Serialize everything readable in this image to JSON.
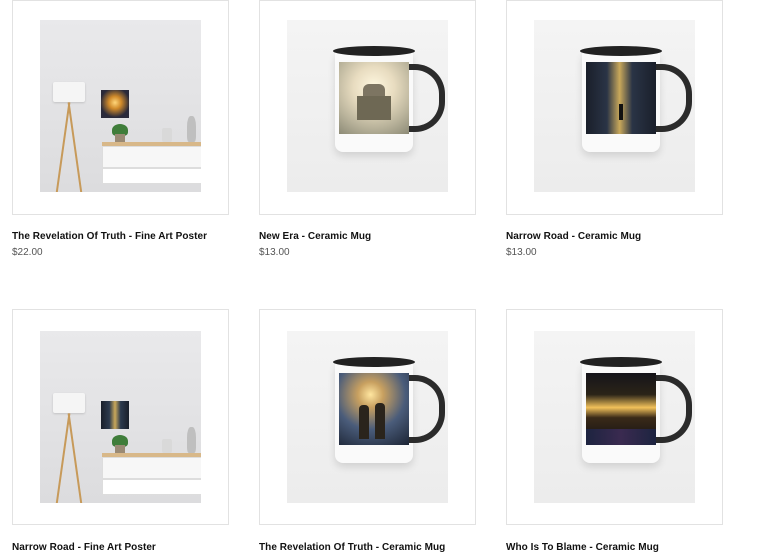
{
  "products": [
    {
      "title": "The Revelation Of Truth - Fine Art Poster",
      "price": "$22.00",
      "image": "poster-room"
    },
    {
      "title": "New Era - Ceramic Mug",
      "price": "$13.00",
      "image": "mug-castle"
    },
    {
      "title": "Narrow Road - Ceramic Mug",
      "price": "$13.00",
      "image": "mug-city"
    },
    {
      "title": "Narrow Road - Fine Art Poster",
      "price": "",
      "image": "poster-room"
    },
    {
      "title": "The Revelation Of Truth - Ceramic Mug",
      "price": "",
      "image": "mug-heroes"
    },
    {
      "title": "Who Is To Blame - Ceramic Mug",
      "price": "",
      "image": "mug-hand"
    }
  ],
  "colors": {
    "border": "#e2e2e2",
    "title": "#111111",
    "price": "#555555"
  }
}
